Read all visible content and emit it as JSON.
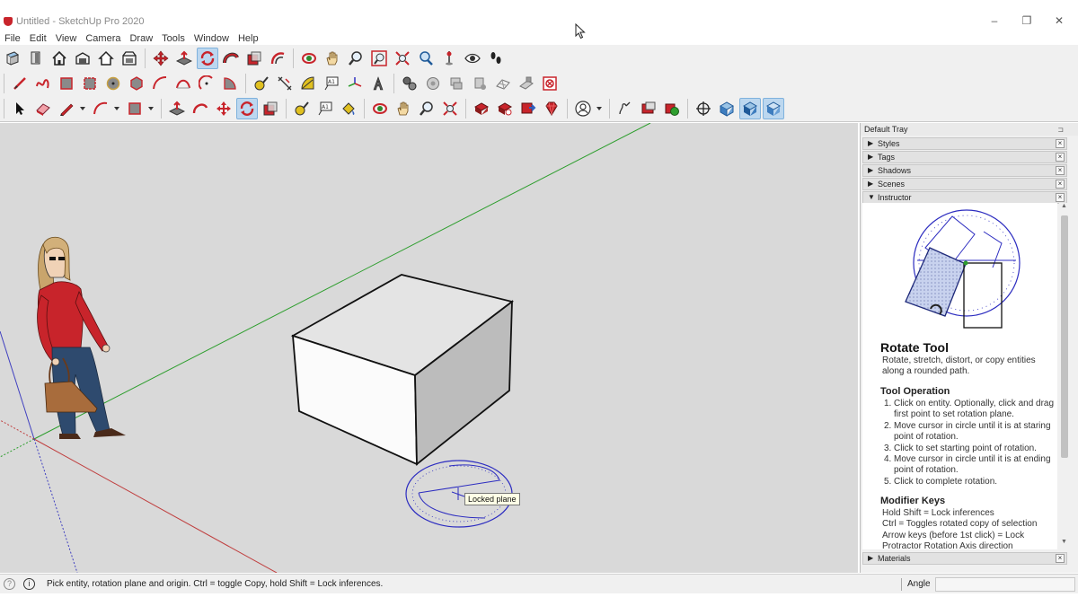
{
  "window": {
    "title": "Untitled - SketchUp Pro 2020",
    "minimize": "–",
    "restore": "❐",
    "close": "✕"
  },
  "menu": [
    "File",
    "Edit",
    "View",
    "Camera",
    "Draw",
    "Tools",
    "Window",
    "Help"
  ],
  "colors": {
    "accent_red": "#c8242b",
    "active_tool": "#bcd7ef",
    "axis_green": "#2e9e2e",
    "axis_red": "#c04040",
    "axis_blue": "#4040c0",
    "protractor": "#2c2cc0"
  },
  "toolbars": {
    "row1": [
      "section-plane-icon",
      "views-icon",
      "home-icon",
      "door-icon",
      "house-icon",
      "shop-icon",
      "move-icon",
      "pushpull-icon",
      "rotate-icon",
      "followme-icon",
      "scale-icon",
      "offset-icon",
      "orbit-icon",
      "pan-icon",
      "zoom-icon",
      "zoom-window-icon",
      "zoom-extents-icon",
      "previous-view-icon",
      "position-camera-icon",
      "look-around-icon",
      "walk-icon"
    ],
    "row2": [
      "line-icon",
      "freehand-icon",
      "rectangle-icon",
      "rotated-rectangle-icon",
      "circle-icon",
      "polygon-icon",
      "arc-icon",
      "two-point-arc-icon",
      "three-point-arc-icon",
      "pie-icon",
      "tape-measure-icon",
      "dimension-icon",
      "protractor-icon",
      "text-icon",
      "axes-icon",
      "3d-text-icon",
      "warehouse-icon",
      "extension-icon",
      "share-icon",
      "model-info-icon",
      "sandbox-icon",
      "stamp-icon",
      "outliner-icon"
    ],
    "row3": [
      "select-icon",
      "eraser-icon",
      "pencil-icon",
      "arc-tool-icon",
      "shape-icon",
      "pushpull-icon",
      "followme-icon",
      "move-icon",
      "rotate-icon",
      "scale-icon",
      "tape-icon",
      "text-icon",
      "paint-bucket-icon",
      "orbit-icon",
      "pan-icon",
      "zoom-icon",
      "zoom-extents-icon",
      "warehouse-icon",
      "extension-warehouse-icon",
      "layout-icon",
      "ruby-icon",
      "account-icon",
      "sandbox-icon",
      "section-icon",
      "solid-icon",
      "style-icon",
      "xray-icon",
      "display-icon"
    ]
  },
  "viewport": {
    "tooltip": "Locked plane"
  },
  "tray": {
    "title": "Default Tray",
    "pin": "⊐",
    "panels": [
      {
        "label": "Styles",
        "state": "collapsed"
      },
      {
        "label": "Tags",
        "state": "collapsed"
      },
      {
        "label": "Shadows",
        "state": "collapsed"
      },
      {
        "label": "Scenes",
        "state": "collapsed"
      },
      {
        "label": "Instructor",
        "state": "expanded"
      }
    ],
    "bottom_panel": {
      "label": "Materials",
      "state": "collapsed"
    },
    "close_glyph": "×",
    "collapsed_arrow": "▶",
    "expanded_arrow": "▼",
    "instructor": {
      "title": "Rotate Tool",
      "description": "Rotate, stretch, distort, or copy entities along a rounded path.",
      "operation_heading": "Tool Operation",
      "operation_steps": [
        {
          "num": "1.",
          "text": "Click on entity. Optionally, click and drag first point to set rotation plane."
        },
        {
          "num": "2.",
          "text": "Move cursor in circle until it is at staring point of rotation."
        },
        {
          "num": "3.",
          "text": "Click to set starting point of rotation."
        },
        {
          "num": "4.",
          "text": "Move cursor in circle until it is at ending point of rotation."
        },
        {
          "num": "5.",
          "text": "Click to complete rotation."
        }
      ],
      "modifier_heading": "Modifier Keys",
      "modifier_lines": [
        "Hold Shift = Lock inferences",
        "Ctrl = Toggles rotated copy of selection",
        "Arrow keys (before 1st click) = Lock Protractor Rotation Axis direction"
      ]
    }
  },
  "status": {
    "message": "Pick entity, rotation plane and origin.  Ctrl = toggle Copy, hold Shift = Lock inferences.",
    "measure_label": "Angle",
    "measure_value": ""
  }
}
